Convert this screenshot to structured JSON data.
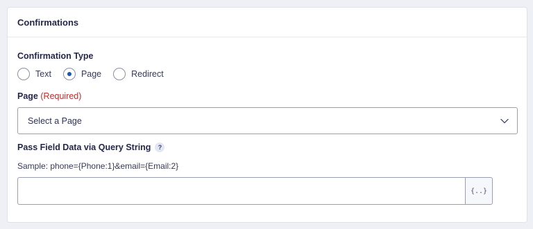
{
  "panel": {
    "title": "Confirmations"
  },
  "confirmation_type": {
    "label": "Confirmation Type",
    "options": [
      {
        "label": "Text",
        "checked": false
      },
      {
        "label": "Page",
        "checked": true
      },
      {
        "label": "Redirect",
        "checked": false
      }
    ]
  },
  "page_field": {
    "label": "Page",
    "required_text": "(Required)",
    "selected": "Select a Page",
    "icon": "chevron-down-icon"
  },
  "query_string": {
    "label": "Pass Field Data via Query String",
    "help_text": "?",
    "sample": "Sample: phone={Phone:1}&email={Email:2}",
    "value": "",
    "merge_tag_label": "{..}",
    "merge_icon": "merge-tag-icon"
  },
  "colors": {
    "accent": "#1a5aa6",
    "required": "#c02b2b",
    "text": "#242748"
  }
}
